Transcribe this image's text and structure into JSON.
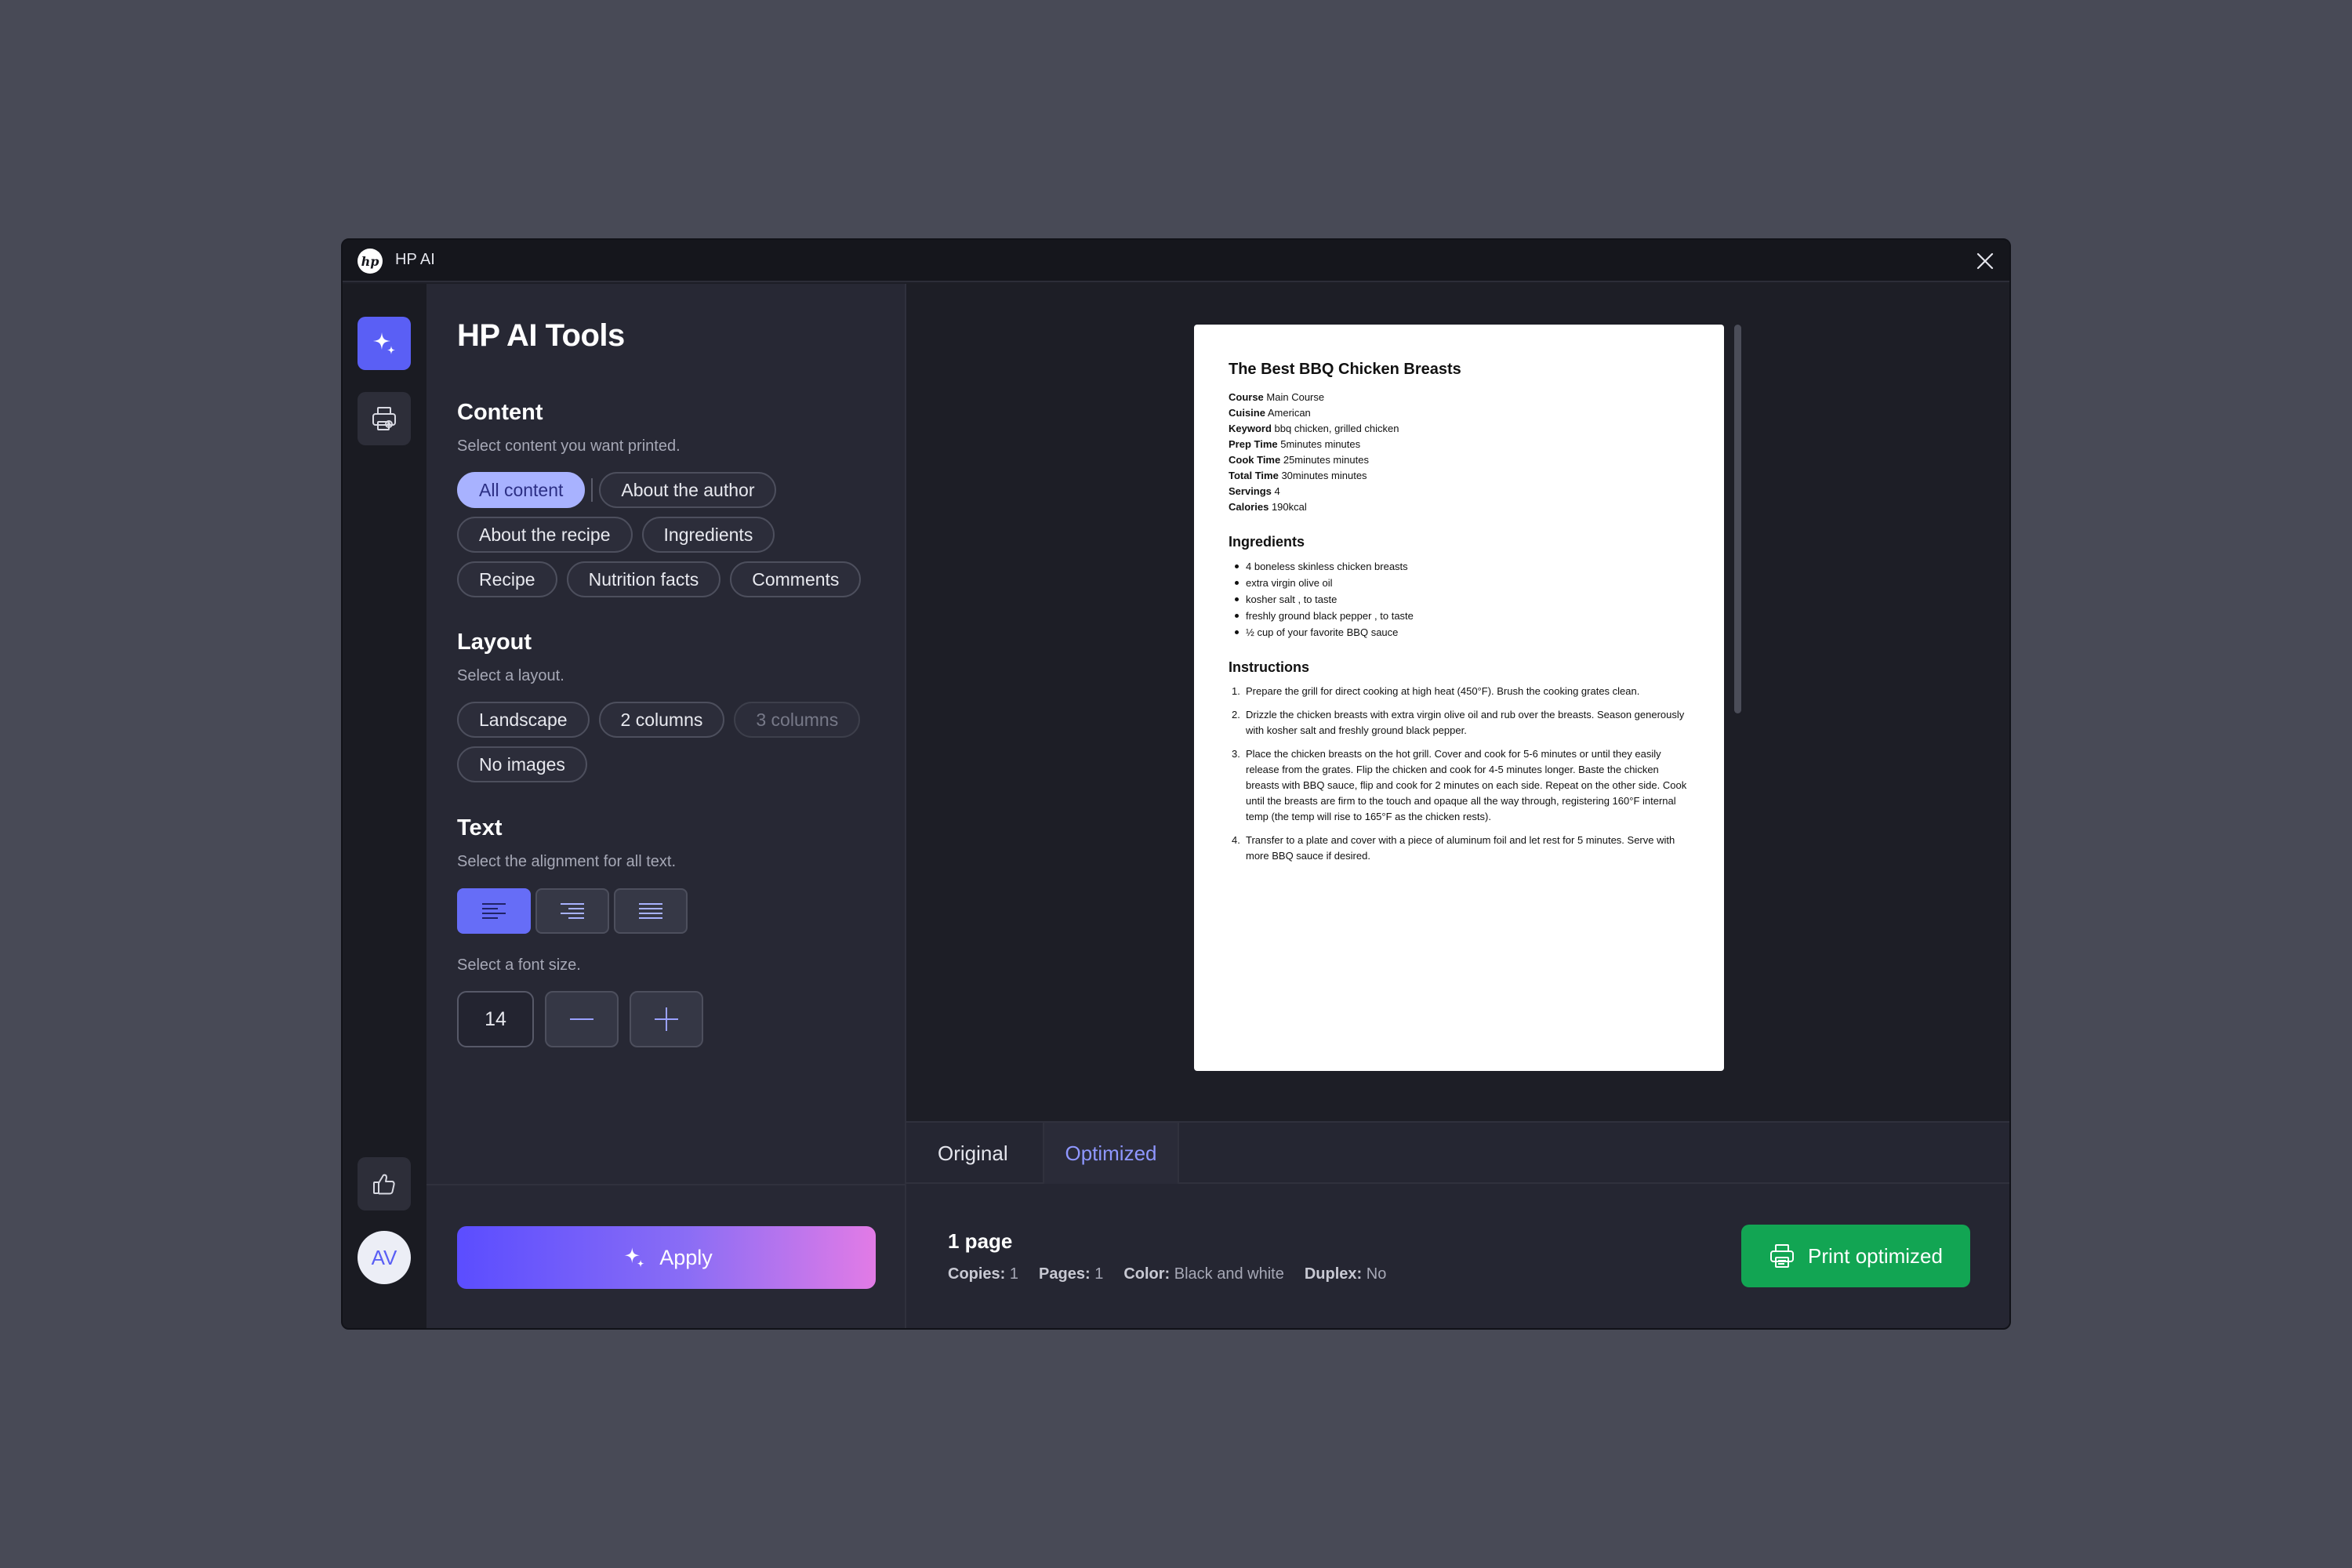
{
  "window": {
    "app_name": "HP AI",
    "logo_text": "hp"
  },
  "rail": {
    "items": [
      {
        "icon": "sparkle-icon",
        "active": true
      },
      {
        "icon": "printer-settings-icon",
        "active": false
      }
    ],
    "feedback_icon": "thumbs-up-icon",
    "avatar_initials": "AV"
  },
  "panel": {
    "title": "HP AI Tools",
    "content": {
      "title": "Content",
      "subtitle": "Select content you want printed.",
      "chips": [
        "All content",
        "About the author",
        "About the recipe",
        "Ingredients",
        "Recipe",
        "Nutrition facts",
        "Comments"
      ],
      "selected": "All content"
    },
    "layout": {
      "title": "Layout",
      "subtitle": "Select a layout.",
      "chips": [
        "Landscape",
        "2 columns",
        "3 columns",
        "No images"
      ],
      "disabled": "3 columns"
    },
    "text": {
      "title": "Text",
      "subtitle": "Select the alignment for all text.",
      "alignments": [
        "align-left-icon",
        "align-right-icon",
        "align-justify-icon"
      ],
      "active_alignment": "align-left-icon",
      "font_label": "Select a font size.",
      "font_size": "14"
    },
    "apply_label": "Apply"
  },
  "document": {
    "title": "The Best BBQ Chicken Breasts",
    "meta": [
      {
        "label": "Course",
        "value": "Main Course"
      },
      {
        "label": "Cuisine",
        "value": "American"
      },
      {
        "label": "Keyword",
        "value": "bbq chicken, grilled chicken"
      },
      {
        "label": "Prep Time",
        "value": "5minutes minutes"
      },
      {
        "label": "Cook Time",
        "value": "25minutes minutes"
      },
      {
        "label": "Total Time",
        "value": "30minutes minutes"
      },
      {
        "label": "Servings",
        "value": "4"
      },
      {
        "label": "Calories",
        "value": "190kcal"
      }
    ],
    "ingredients_title": "Ingredients",
    "ingredients": [
      "4 boneless skinless chicken breasts",
      "extra virgin olive oil",
      "kosher salt , to taste",
      "freshly ground black pepper , to taste",
      "½ cup of your favorite BBQ sauce"
    ],
    "instructions_title": "Instructions",
    "instructions": [
      "Prepare the grill for direct cooking at high heat (450°F). Brush the cooking grates clean.",
      "Drizzle the chicken breasts with extra virgin olive oil and rub over the breasts. Season generously with kosher salt and freshly ground black pepper.",
      "Place the chicken breasts on the hot grill. Cover and cook for 5-6 minutes or until they easily release from the grates. Flip the chicken and cook for 4-5 minutes longer. Baste the chicken breasts with BBQ sauce, flip and cook for 2 minutes on each side. Repeat on the other side. Cook until the breasts are firm to the touch and opaque all the way through, registering 160°F internal temp (the temp will rise to 165°F as the chicken rests).",
      "Transfer to a plate and cover with a piece of aluminum foil and let rest for 5 minutes. Serve with more BBQ sauce if desired."
    ]
  },
  "tabs": {
    "original": "Original",
    "optimized": "Optimized",
    "active": "Optimized"
  },
  "summary": {
    "title": "1 page",
    "copies_label": "Copies:",
    "copies": "1",
    "pages_label": "Pages:",
    "pages": "1",
    "color_label": "Color:",
    "color": "Black and white",
    "duplex_label": "Duplex:",
    "duplex": "No",
    "print_label": "Print optimized"
  },
  "colors": {
    "accent": "#5a5ff5",
    "print_green": "#12a553",
    "selected_chip": "#a8b2ff",
    "tab_active": "#8f97ff"
  }
}
